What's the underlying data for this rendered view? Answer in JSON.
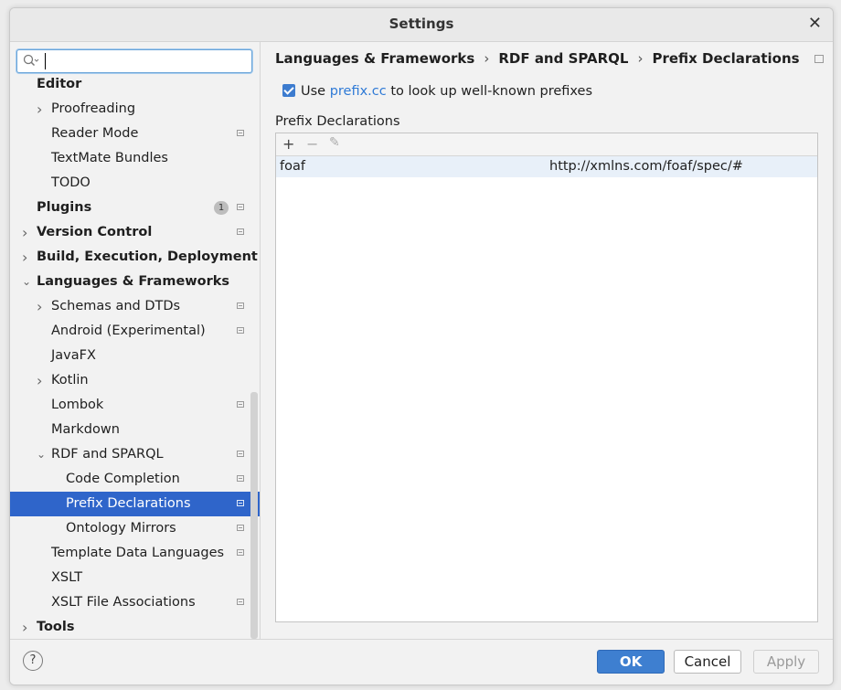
{
  "window": {
    "title": "Settings"
  },
  "search": {
    "value": "",
    "placeholder": ""
  },
  "tree": [
    {
      "label": "Editor",
      "level": 0,
      "bold": true,
      "chev": "",
      "gear": false
    },
    {
      "label": "Proofreading",
      "level": 1,
      "bold": false,
      "chev": "right",
      "gear": false
    },
    {
      "label": "Reader Mode",
      "level": 1,
      "bold": false,
      "chev": "",
      "gear": true
    },
    {
      "label": "TextMate Bundles",
      "level": 1,
      "bold": false,
      "chev": "",
      "gear": false
    },
    {
      "label": "TODO",
      "level": 1,
      "bold": false,
      "chev": "",
      "gear": false
    },
    {
      "label": "Plugins",
      "level": 0,
      "bold": true,
      "chev": "",
      "gear": true,
      "badge": "1"
    },
    {
      "label": "Version Control",
      "level": 0,
      "bold": true,
      "chev": "right",
      "gear": true
    },
    {
      "label": "Build, Execution, Deployment",
      "level": 0,
      "bold": true,
      "chev": "right",
      "gear": false
    },
    {
      "label": "Languages & Frameworks",
      "level": 0,
      "bold": true,
      "chev": "down",
      "gear": false
    },
    {
      "label": "Schemas and DTDs",
      "level": 1,
      "bold": false,
      "chev": "right",
      "gear": true
    },
    {
      "label": "Android (Experimental)",
      "level": 1,
      "bold": false,
      "chev": "",
      "gear": true
    },
    {
      "label": "JavaFX",
      "level": 1,
      "bold": false,
      "chev": "",
      "gear": false
    },
    {
      "label": "Kotlin",
      "level": 1,
      "bold": false,
      "chev": "right",
      "gear": false
    },
    {
      "label": "Lombok",
      "level": 1,
      "bold": false,
      "chev": "",
      "gear": true
    },
    {
      "label": "Markdown",
      "level": 1,
      "bold": false,
      "chev": "",
      "gear": false
    },
    {
      "label": "RDF and SPARQL",
      "level": 1,
      "bold": false,
      "chev": "down",
      "gear": true
    },
    {
      "label": "Code Completion",
      "level": 2,
      "bold": false,
      "chev": "",
      "gear": true
    },
    {
      "label": "Prefix Declarations",
      "level": 2,
      "bold": false,
      "chev": "",
      "gear": true,
      "selected": true
    },
    {
      "label": "Ontology Mirrors",
      "level": 2,
      "bold": false,
      "chev": "",
      "gear": true
    },
    {
      "label": "Template Data Languages",
      "level": 1,
      "bold": false,
      "chev": "",
      "gear": true
    },
    {
      "label": "XSLT",
      "level": 1,
      "bold": false,
      "chev": "",
      "gear": false
    },
    {
      "label": "XSLT File Associations",
      "level": 1,
      "bold": false,
      "chev": "",
      "gear": true
    },
    {
      "label": "Tools",
      "level": 0,
      "bold": true,
      "chev": "right",
      "gear": false
    }
  ],
  "breadcrumb": {
    "items": [
      "Languages & Frameworks",
      "RDF and SPARQL",
      "Prefix Declarations"
    ],
    "separator": "›"
  },
  "option": {
    "checked": true,
    "prefix_text": "Use",
    "link_text": "prefix.cc",
    "suffix_text": "to look up well-known prefixes"
  },
  "section": {
    "label": "Prefix Declarations"
  },
  "table": {
    "toolbar": {
      "add": "+",
      "remove": "−",
      "edit": "✎"
    },
    "rows": [
      {
        "prefix": "foaf",
        "uri": "http://xmlns.com/foaf/spec/#"
      }
    ]
  },
  "footer": {
    "help": "?",
    "ok": "OK",
    "cancel": "Cancel",
    "apply": "Apply"
  },
  "colors": {
    "selection": "#2f65ca",
    "accent": "#3e7fd0",
    "link": "#2f7ad6"
  }
}
